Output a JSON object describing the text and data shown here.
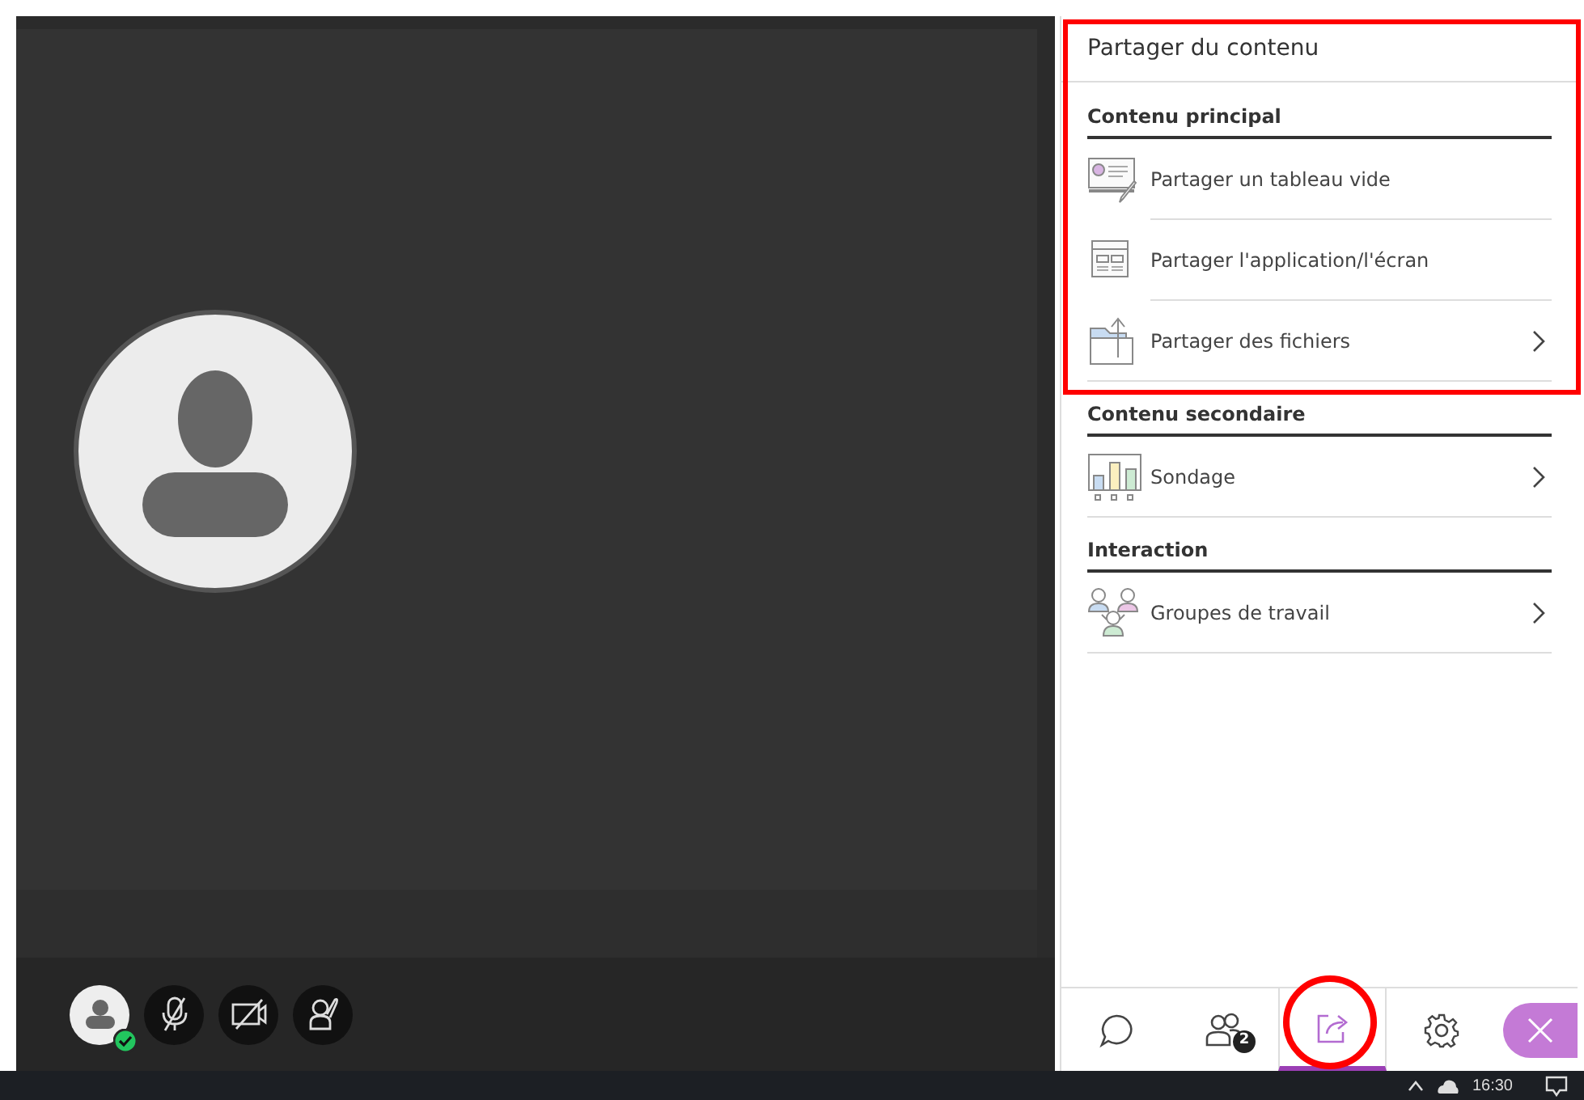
{
  "panel": {
    "title": "Partager du contenu",
    "sections": [
      {
        "heading": "Contenu principal",
        "items": [
          {
            "kind": "whiteboard",
            "label": "Partager un tableau vide",
            "has_arrow": false
          },
          {
            "kind": "screen",
            "label": "Partager l'application/l'écran",
            "has_arrow": false
          },
          {
            "kind": "files",
            "label": "Partager des fichiers",
            "has_arrow": true
          }
        ]
      },
      {
        "heading": "Contenu secondaire",
        "items": [
          {
            "kind": "poll",
            "label": "Sondage",
            "has_arrow": true
          }
        ]
      },
      {
        "heading": "Interaction",
        "items": [
          {
            "kind": "groups",
            "label": "Groupes de travail",
            "has_arrow": true
          }
        ]
      }
    ]
  },
  "tabs": [
    {
      "kind": "chat",
      "selected": false
    },
    {
      "kind": "participants",
      "selected": false,
      "badge": "2"
    },
    {
      "kind": "share",
      "selected": true
    },
    {
      "kind": "settings",
      "selected": false
    }
  ],
  "taskbar": {
    "time": "16:30"
  }
}
